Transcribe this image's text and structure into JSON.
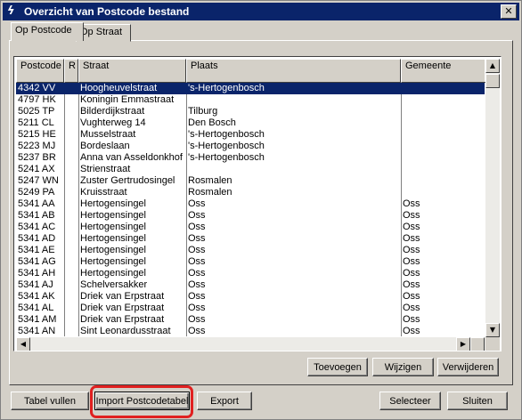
{
  "window": {
    "title": "Overzicht van Postcode bestand",
    "close_label": "✕"
  },
  "tabs": [
    {
      "label": "Op Postcode"
    },
    {
      "label": "Op Straat"
    }
  ],
  "grid": {
    "headers": {
      "postcode": "Postcode",
      "r": "R",
      "straat": "Straat",
      "plaats": "Plaats",
      "gemeente": "Gemeente"
    },
    "rows": [
      {
        "postcode": "4342 VV",
        "r": "",
        "straat": "Hoogheuvelstraat",
        "plaats": "'s-Hertogenbosch",
        "gemeente": "",
        "selected": true
      },
      {
        "postcode": "4797 HK",
        "r": "",
        "straat": "Koningin Emmastraat",
        "plaats": "",
        "gemeente": ""
      },
      {
        "postcode": "5025 TP",
        "r": "",
        "straat": "Bilderdijkstraat",
        "plaats": "Tilburg",
        "gemeente": ""
      },
      {
        "postcode": "5211 CL",
        "r": "",
        "straat": "Vughterweg 14",
        "plaats": "Den Bosch",
        "gemeente": ""
      },
      {
        "postcode": "5215 HE",
        "r": "",
        "straat": "Musselstraat",
        "plaats": "'s-Hertogenbosch",
        "gemeente": ""
      },
      {
        "postcode": "5223 MJ",
        "r": "",
        "straat": "Bordeslaan",
        "plaats": "'s-Hertogenbosch",
        "gemeente": ""
      },
      {
        "postcode": "5237 BR",
        "r": "",
        "straat": "Anna van Asseldonkhof",
        "plaats": "'s-Hertogenbosch",
        "gemeente": ""
      },
      {
        "postcode": "5241 AX",
        "r": "",
        "straat": "Strienstraat",
        "plaats": "",
        "gemeente": ""
      },
      {
        "postcode": "5247 WN",
        "r": "",
        "straat": "Zuster Gertrudosingel",
        "plaats": "Rosmalen",
        "gemeente": ""
      },
      {
        "postcode": "5249 PA",
        "r": "",
        "straat": "Kruisstraat",
        "plaats": "Rosmalen",
        "gemeente": ""
      },
      {
        "postcode": "5341 AA",
        "r": "",
        "straat": "Hertogensingel",
        "plaats": "Oss",
        "gemeente": "Oss"
      },
      {
        "postcode": "5341 AB",
        "r": "",
        "straat": "Hertogensingel",
        "plaats": "Oss",
        "gemeente": "Oss"
      },
      {
        "postcode": "5341 AC",
        "r": "",
        "straat": "Hertogensingel",
        "plaats": "Oss",
        "gemeente": "Oss"
      },
      {
        "postcode": "5341 AD",
        "r": "",
        "straat": "Hertogensingel",
        "plaats": "Oss",
        "gemeente": "Oss"
      },
      {
        "postcode": "5341 AE",
        "r": "",
        "straat": "Hertogensingel",
        "plaats": "Oss",
        "gemeente": "Oss"
      },
      {
        "postcode": "5341 AG",
        "r": "",
        "straat": "Hertogensingel",
        "plaats": "Oss",
        "gemeente": "Oss"
      },
      {
        "postcode": "5341 AH",
        "r": "",
        "straat": "Hertogensingel",
        "plaats": "Oss",
        "gemeente": "Oss"
      },
      {
        "postcode": "5341 AJ",
        "r": "",
        "straat": "Schelversakker",
        "plaats": "Oss",
        "gemeente": "Oss"
      },
      {
        "postcode": "5341 AK",
        "r": "",
        "straat": "Driek van Erpstraat",
        "plaats": "Oss",
        "gemeente": "Oss"
      },
      {
        "postcode": "5341 AL",
        "r": "",
        "straat": "Driek van Erpstraat",
        "plaats": "Oss",
        "gemeente": "Oss"
      },
      {
        "postcode": "5341 AM",
        "r": "",
        "straat": "Driek van Erpstraat",
        "plaats": "Oss",
        "gemeente": "Oss"
      },
      {
        "postcode": "5341 AN",
        "r": "",
        "straat": "Sint Leonardusstraat",
        "plaats": "Oss",
        "gemeente": "Oss"
      }
    ]
  },
  "buttons": {
    "toevoegen": "Toevoegen",
    "wijzigen": "Wijzigen",
    "verwijderen": "Verwijderen",
    "tabel_vullen": "Tabel vullen",
    "import": "Import Postcodetabel",
    "export": "Export",
    "selecteer": "Selecteer",
    "sluiten": "Sluiten"
  },
  "colors": {
    "selection": "#0a246a",
    "highlight_ring": "#e02020",
    "face": "#d4d0c8"
  }
}
